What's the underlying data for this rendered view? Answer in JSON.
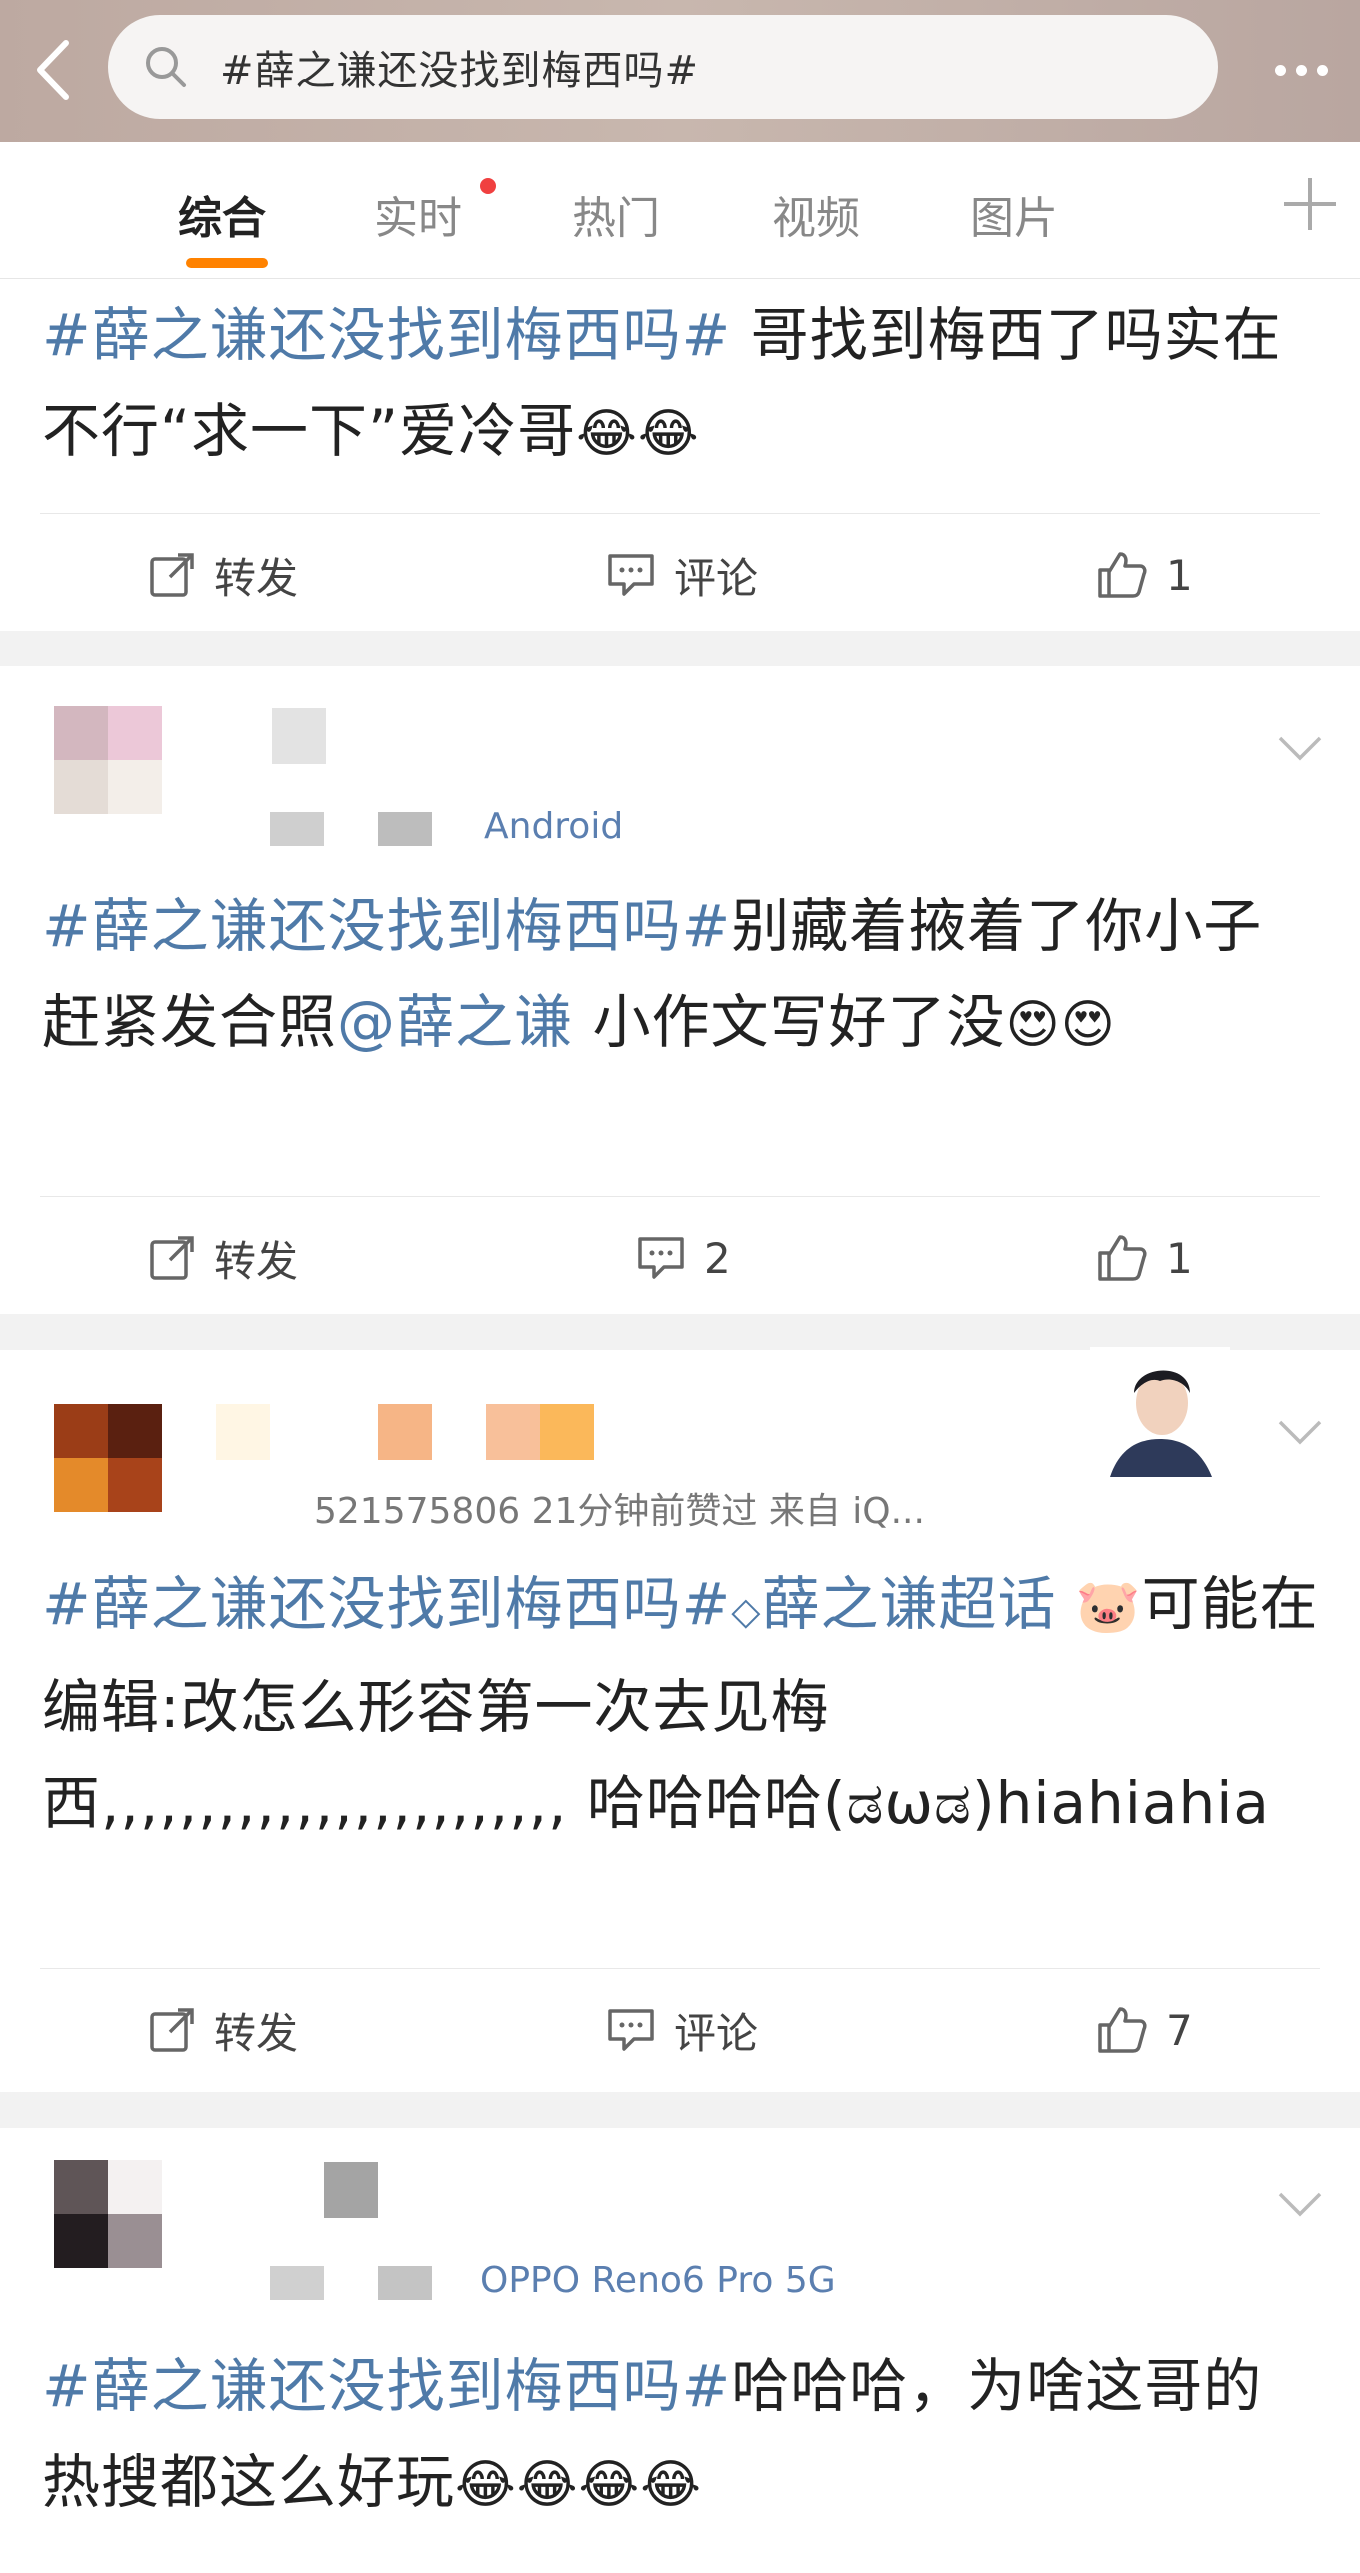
{
  "search": {
    "query": "#薛之谦还没找到梅西吗#"
  },
  "tabs": [
    {
      "label": "综合"
    },
    {
      "label": "实时"
    },
    {
      "label": "热门"
    },
    {
      "label": "视频"
    },
    {
      "label": "图片"
    }
  ],
  "posts": [
    {
      "topic": "#薛之谦还没找到梅西吗#",
      "text": " 哥找到梅西了吗实在不行“求一下”爱冷哥",
      "emoji": "😂😂",
      "repost_label": "转发",
      "comment_label": "评论",
      "like_count": "1"
    },
    {
      "meta_source": "Android",
      "topic": "#薛之谦还没找到梅西吗#",
      "text": "别藏着掖着了你小子赶紧发合照",
      "mention": "@薛之谦",
      "text2": " 小作文写好了没",
      "emoji": "😍😍",
      "repost_label": "转发",
      "comment_count": "2",
      "like_count": "1"
    },
    {
      "meta_time": "521575806  21分钟前赞过  来自 iQ...",
      "topic": "#薛之谦还没找到梅西吗#",
      "super_topic": "薛之谦超话",
      "emoji": "🐷",
      "text": "可能在编辑:改怎么形容第一次去见梅西,,,,,,,,,,,,,,,,,,,,,,,, 哈哈哈哈(ಡωಡ)hiahiahia",
      "repost_label": "转发",
      "comment_label": "评论",
      "like_count": "7"
    },
    {
      "meta_source": "OPPO Reno6 Pro 5G",
      "topic": "#薛之谦还没找到梅西吗#",
      "text": "哈哈哈，为啥这哥的热搜都这么好玩",
      "emoji": "😂😂😂😂"
    }
  ]
}
